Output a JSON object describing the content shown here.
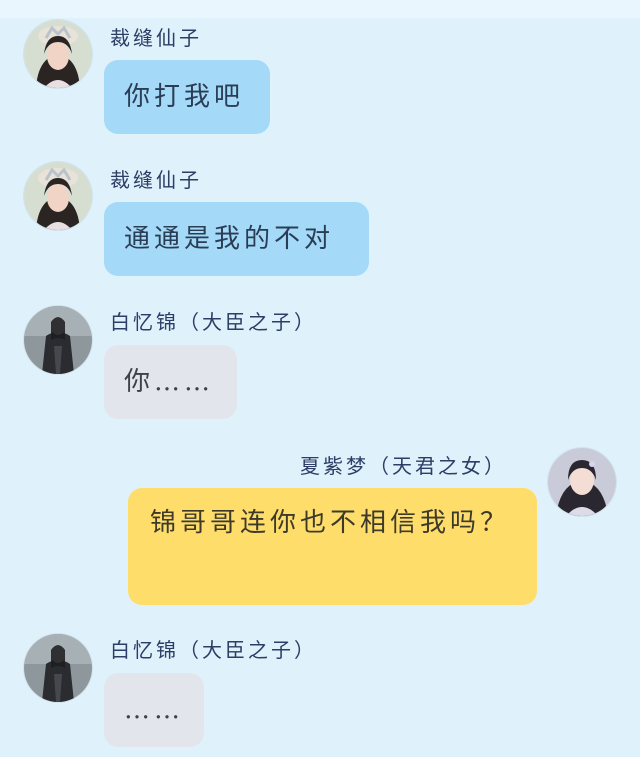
{
  "colors": {
    "background": "#dff1fb",
    "bubble_blue": "#a4daf8",
    "bubble_gray": "#e2e6ec",
    "bubble_yellow": "#fedd6a",
    "name_text": "#2c3d66"
  },
  "messages": [
    {
      "sender": "裁缝仙子",
      "text": "你打我吧",
      "side": "left",
      "bubble": "blue",
      "avatar_icon": "fairy-avatar-icon"
    },
    {
      "sender": "裁缝仙子",
      "text": "通通是我的不对",
      "side": "left",
      "bubble": "blue",
      "avatar_icon": "fairy-avatar-icon"
    },
    {
      "sender": "白忆锦（大臣之子）",
      "text": "你……",
      "side": "left",
      "bubble": "gray",
      "avatar_icon": "minister-son-avatar-icon"
    },
    {
      "sender": "夏紫梦（天君之女）",
      "text": "锦哥哥连你也不相信我吗？",
      "side": "right",
      "bubble": "yellow",
      "avatar_icon": "princess-avatar-icon"
    },
    {
      "sender": "白忆锦（大臣之子）",
      "text": "……",
      "side": "left",
      "bubble": "gray",
      "avatar_icon": "minister-son-avatar-icon"
    }
  ]
}
